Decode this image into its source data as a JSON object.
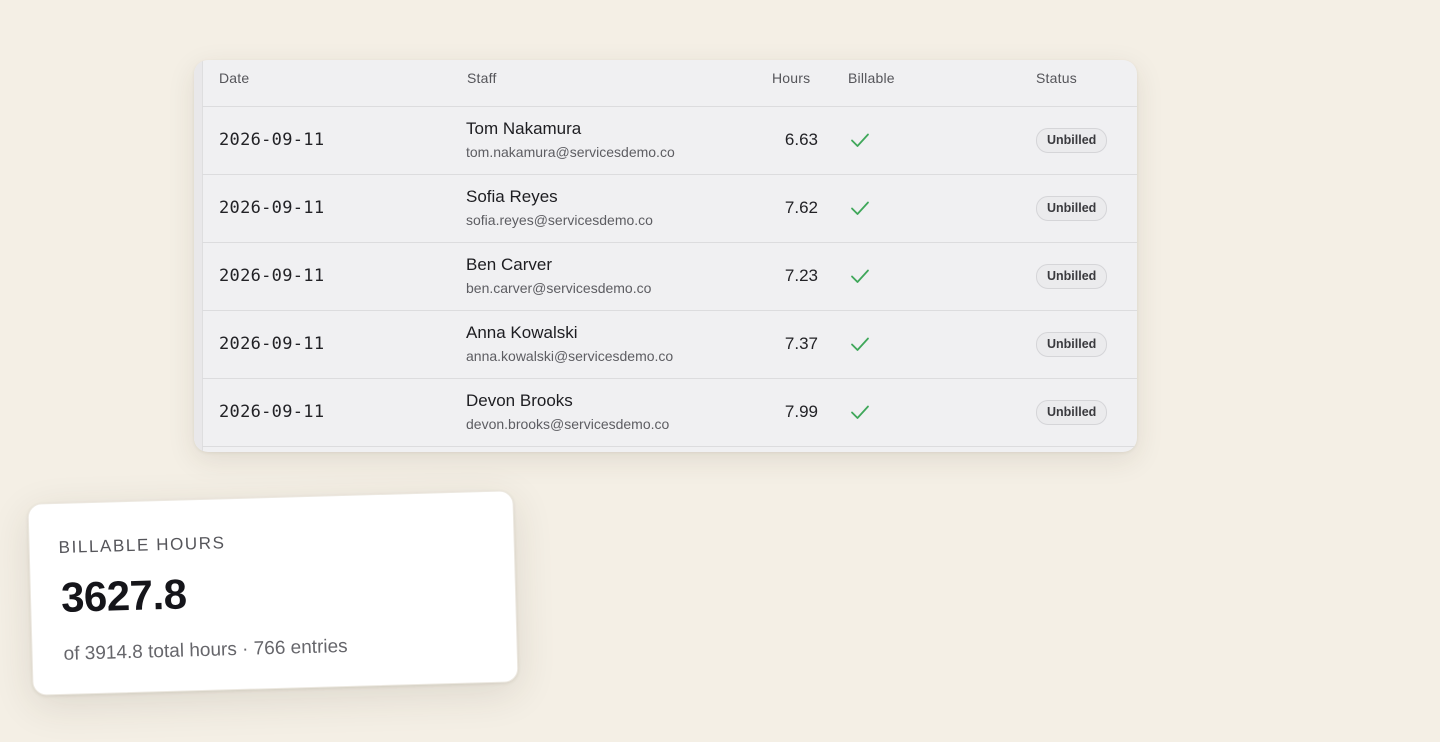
{
  "table": {
    "headers": {
      "date": "Date",
      "staff": "Staff",
      "hours": "Hours",
      "billable": "Billable",
      "status": "Status"
    },
    "rows": [
      {
        "date": "2026-09-11",
        "name": "Tom Nakamura",
        "email": "tom.nakamura@servicesdemo.co",
        "hours": "6.63",
        "billable": "check-icon",
        "status": "Unbilled"
      },
      {
        "date": "2026-09-11",
        "name": "Sofia Reyes",
        "email": "sofia.reyes@servicesdemo.co",
        "hours": "7.62",
        "billable": "check-icon",
        "status": "Unbilled"
      },
      {
        "date": "2026-09-11",
        "name": "Ben Carver",
        "email": "ben.carver@servicesdemo.co",
        "hours": "7.23",
        "billable": "check-icon",
        "status": "Unbilled"
      },
      {
        "date": "2026-09-11",
        "name": "Anna Kowalski",
        "email": "anna.kowalski@servicesdemo.co",
        "hours": "7.37",
        "billable": "check-icon",
        "status": "Unbilled"
      },
      {
        "date": "2026-09-11",
        "name": "Devon Brooks",
        "email": "devon.brooks@servicesdemo.co",
        "hours": "7.99",
        "billable": "check-icon",
        "status": "Unbilled"
      }
    ]
  },
  "stat": {
    "label": "BILLABLE HOURS",
    "value": "3627.8",
    "subtitle": "of 3914.8 total hours · 766 entries"
  },
  "colors": {
    "background": "#f4efe5",
    "check": "#3fa75a"
  }
}
